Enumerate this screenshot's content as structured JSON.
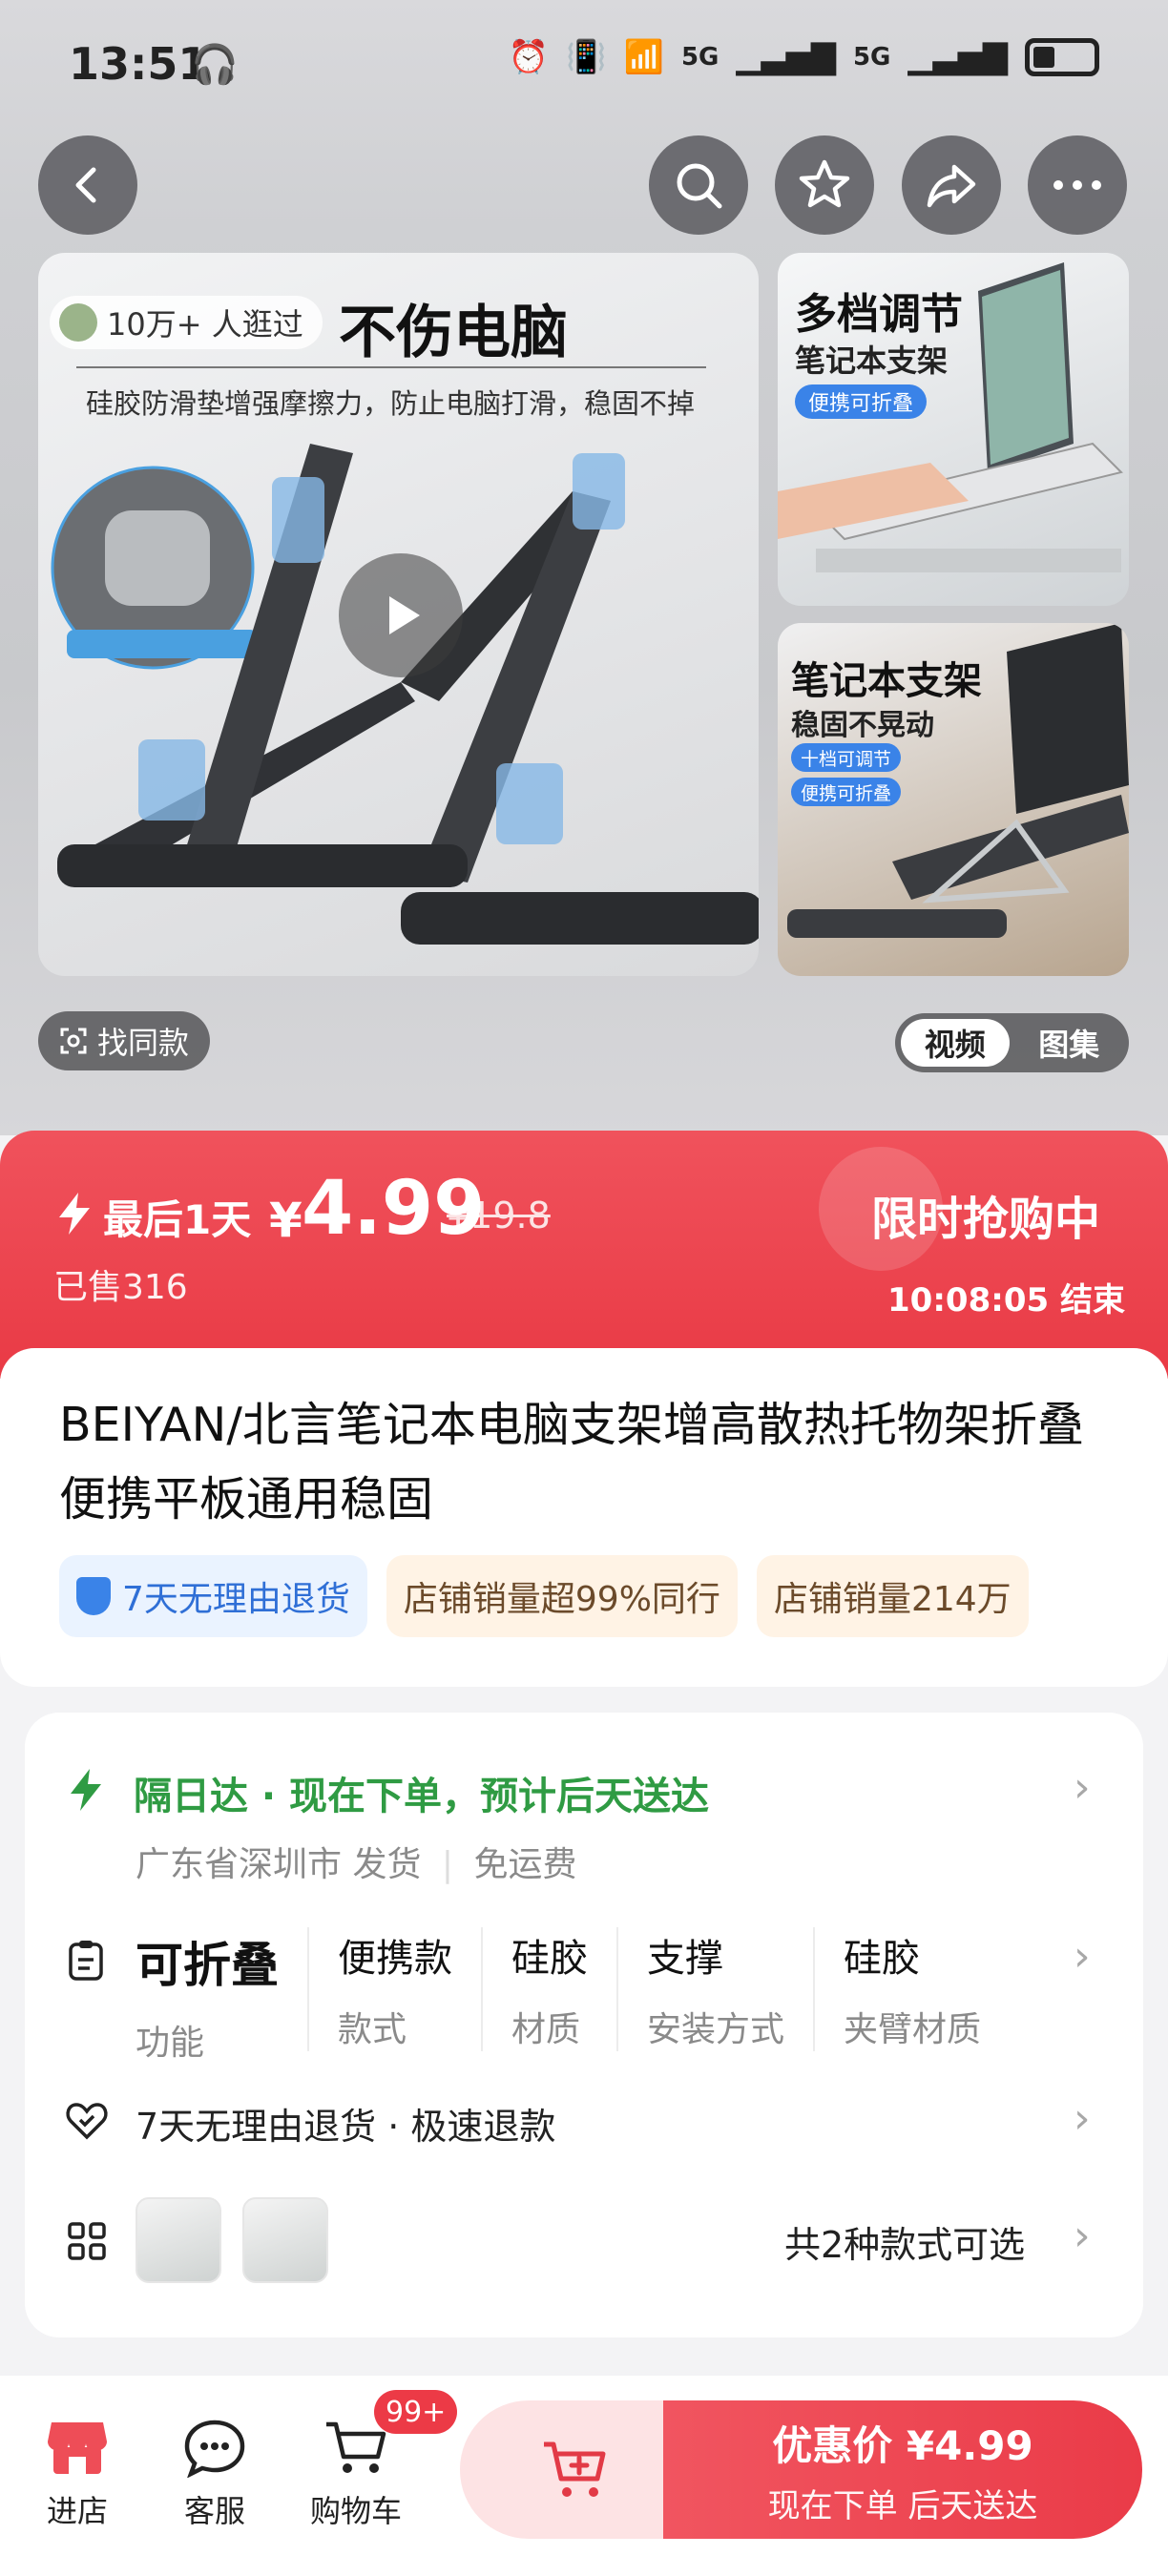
{
  "status_bar": {
    "time": "13:51",
    "signal_1": "5G",
    "signal_2": "5G"
  },
  "gallery": {
    "visitors": "10万+ 人逛过",
    "headline": "不伤电脑",
    "subline": "硅胶防滑垫增强摩擦力，防止电脑打滑，稳固不掉",
    "side_top": {
      "title": "多档调节",
      "subtitle": "笔记本支架",
      "chip": "便携可折叠"
    },
    "side_bottom": {
      "title": "笔记本支架",
      "subtitle": "稳固不晃动",
      "chip_1": "十档可调节",
      "chip_2": "便携可折叠"
    },
    "find_same": "找同款",
    "toggle_video": "视频",
    "toggle_gallery": "图集"
  },
  "promo": {
    "last_day": "最后1天",
    "currency": "¥",
    "price": "4.99",
    "original_price": "¥19.8",
    "sold": "已售316",
    "flash_label": "限时抢购中",
    "countdown": "10:08:05 结束"
  },
  "product": {
    "title": "BEIYAN/北言笔记本电脑支架增高散热托物架折叠便携平板通用稳固",
    "tags": [
      "7天无理由退货",
      "店铺销量超99%同行",
      "店铺销量214万"
    ]
  },
  "shipping": {
    "title": "隔日达 · 现在下单，预计后天送达",
    "origin": "广东省深圳市 发货",
    "fee": "免运费"
  },
  "specs": [
    {
      "value": "可折叠",
      "key": "功能"
    },
    {
      "value": "便携款",
      "key": "款式"
    },
    {
      "value": "硅胶",
      "key": "材质"
    },
    {
      "value": "支撑",
      "key": "安装方式"
    },
    {
      "value": "硅胶",
      "key": "夹臂材质"
    }
  ],
  "returns": {
    "text": "7天无理由退货 · 极速退款"
  },
  "variants": {
    "text": "共2种款式可选"
  },
  "bottom_nav": {
    "store": "进店",
    "service": "客服",
    "cart": "购物车",
    "cart_badge": "99+",
    "buy_price": "优惠价 ¥4.99",
    "buy_sub": "现在下单  后天送达"
  },
  "colors": {
    "accent": "#EA3B48",
    "ship_green": "#2F9B43",
    "tag_blue": "#2F6FD6"
  }
}
